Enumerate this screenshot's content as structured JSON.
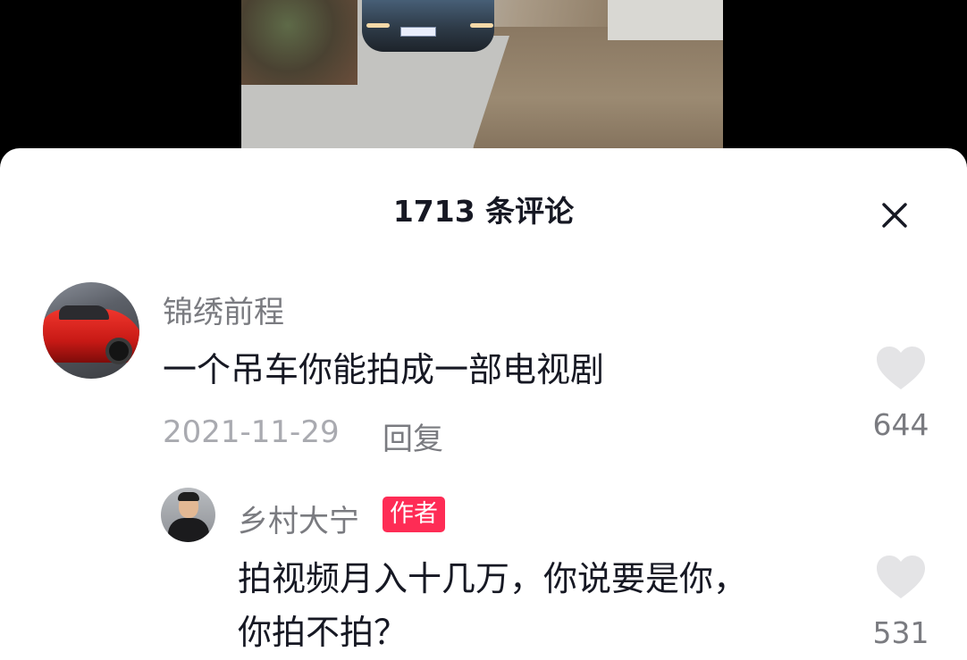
{
  "header": {
    "title": "1713 条评论"
  },
  "comments": [
    {
      "user": "锦绣前程",
      "text": "一个吊车你能拍成一部电视剧",
      "date": "2021-11-29",
      "reply_label": "回复",
      "likes": "644",
      "avatar": "red-sports-car"
    }
  ],
  "replies": [
    {
      "user": "乡村大宁",
      "badge": "作者",
      "text_line1": "拍视频月入十几万，你说要是你，",
      "text_line2": "你拍不拍？",
      "likes": "531",
      "avatar": "man-portrait"
    }
  ],
  "icons": {
    "close": "close-icon",
    "like": "heart-icon"
  },
  "colors": {
    "badge": "#fe2c55",
    "heart": "#e4e4e6",
    "text": "#161823",
    "muted": "#7a7b80"
  }
}
